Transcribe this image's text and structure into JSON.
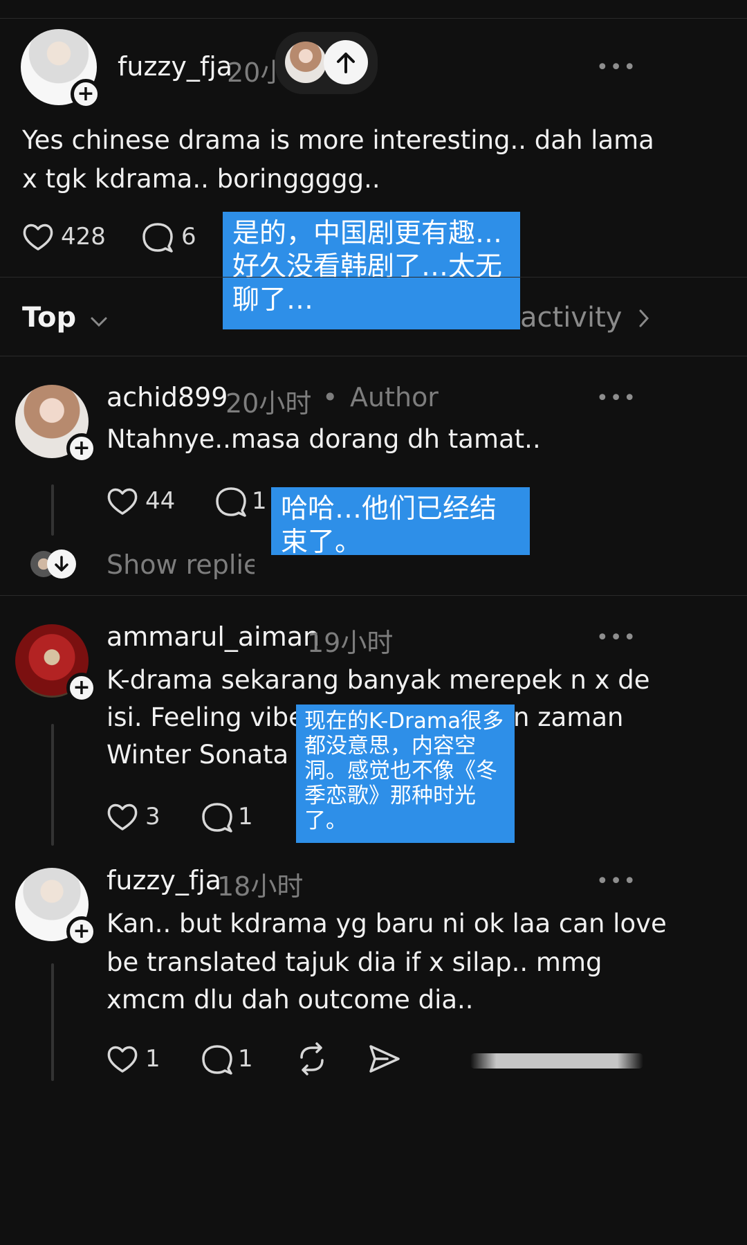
{
  "post": {
    "username": "fuzzy_fja",
    "time": "20小",
    "text_line1": "Yes chinese drama is more interesting.. dah lama",
    "text_line2": "x tgk kdrama.. boringgggg..",
    "likes": "428",
    "replies": "6",
    "more": "•••",
    "translation": "是的，中国剧更有趣…好久没看韩剧了…太无聊了…"
  },
  "sort_bar": {
    "sort_label": "Top",
    "activity_label": "activity"
  },
  "comments": [
    {
      "username": "achid899",
      "time": "20小时",
      "author_badge": "Author",
      "text_lines": [
        "Ntahnye..masa dorang dh tamat.."
      ],
      "likes": "44",
      "replies": "1",
      "show_replies": "Show replies",
      "translation": "哈哈…他们已经结束了。"
    },
    {
      "username": "ammarul_aiman",
      "time": "19小时",
      "text_lines": [
        "K-drama sekarang banyak merepek n x de",
        "isi. Feeling viben",
        "Winter Sonata"
      ],
      "text_tail": "n zaman",
      "likes": "3",
      "replies": "1",
      "translation": "现在的K-Drama很多都没意思，内容空洞。感觉也不像《冬季恋歌》那种时光了。"
    },
    {
      "username": "fuzzy_fja",
      "time": "18小时",
      "text_lines": [
        "Kan.. but kdrama yg baru ni ok laa can love",
        "be translated tajuk dia if  x silap.. mmg",
        "xmcm dlu dah outcome dia.."
      ],
      "likes": "1",
      "replies": "1"
    }
  ],
  "icons": {
    "more": "more-horizontal-icon",
    "like": "heart-icon",
    "reply": "comment-bubble-icon",
    "repost": "repost-icon",
    "share": "send-icon",
    "scroll_top": "arrow-up-icon",
    "expand": "arrow-down-icon",
    "follow": "plus-icon",
    "sort": "chevron-down-icon",
    "activity": "chevron-right-icon"
  },
  "colors": {
    "background": "#101010",
    "translation_overlay": "#2e8fe8"
  }
}
